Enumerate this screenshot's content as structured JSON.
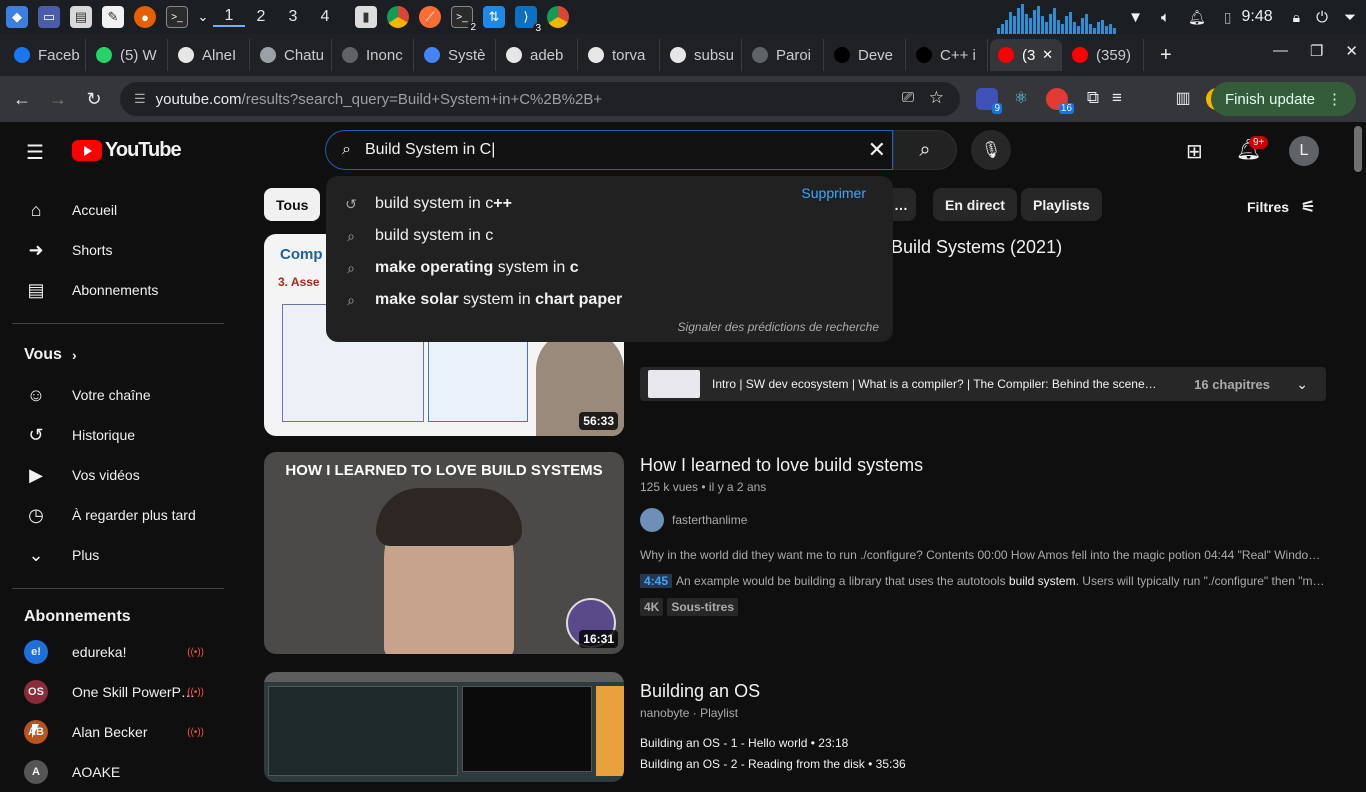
{
  "taskbar": {
    "workspaces": [
      "1",
      "2",
      "3",
      "4"
    ],
    "clock": "9:48",
    "badges": {
      "terminal": "2",
      "vscode": "3"
    }
  },
  "browser": {
    "tabs": [
      {
        "label": "Faceb",
        "icon": "facebook-icon",
        "color": "#1877f2"
      },
      {
        "label": "(5) W",
        "icon": "whatsapp-icon",
        "color": "#25d366"
      },
      {
        "label": "AlneI",
        "icon": "github-icon",
        "color": "#e6e6e6"
      },
      {
        "label": "Chatu",
        "icon": "openai-icon",
        "color": "#9aa0a6"
      },
      {
        "label": "Inonc",
        "icon": "page-icon",
        "color": "#5f6368"
      },
      {
        "label": "Systè",
        "icon": "google-icon",
        "color": "#4285f4"
      },
      {
        "label": "adeb",
        "icon": "github-icon",
        "color": "#e6e6e6"
      },
      {
        "label": "torva",
        "icon": "github-icon",
        "color": "#e6e6e6"
      },
      {
        "label": "subsu",
        "icon": "github-icon",
        "color": "#e6e6e6"
      },
      {
        "label": "Paroi",
        "icon": "page-icon",
        "color": "#5f6368"
      },
      {
        "label": "Deve",
        "icon": "devto-icon",
        "color": "#000000"
      },
      {
        "label": "C++ i",
        "icon": "devto-icon",
        "color": "#000000"
      },
      {
        "label": "(3",
        "icon": "youtube-icon",
        "color": "#ff0000",
        "active": true
      },
      {
        "label": "(359)",
        "icon": "youtube-icon",
        "color": "#ff0000"
      }
    ],
    "url_host": "youtube.com",
    "url_path": "/results?search_query=Build+System+in+C%2B%2B+",
    "finish_update": "Finish update",
    "ext_badges": {
      "a": "9",
      "b": "16"
    }
  },
  "youtube": {
    "logo_text": "YouTube",
    "search_value": "Build System in C",
    "notif_count": "9+",
    "avatar_letter": "L",
    "suggestions": {
      "items": [
        {
          "icon": "history-icon",
          "plain": "build system in c",
          "bold": "++",
          "bold_prefix": ""
        },
        {
          "icon": "search-icon",
          "plain": "build system in c",
          "bold": "",
          "bold_prefix": ""
        },
        {
          "icon": "search-icon",
          "bold_prefix": "make operating",
          "plain": " system in ",
          "bold": "c"
        },
        {
          "icon": "search-icon",
          "bold_prefix": "make solar",
          "plain": " system in ",
          "bold": "chart paper"
        }
      ],
      "delete_label": "Supprimer",
      "report_label": "Signaler des prédictions de recherche"
    },
    "sidebar": {
      "main": [
        {
          "label": "Accueil",
          "icon": "home-icon"
        },
        {
          "label": "Shorts",
          "icon": "shorts-icon"
        },
        {
          "label": "Abonnements",
          "icon": "subscriptions-icon"
        }
      ],
      "you_heading": "Vous",
      "you": [
        {
          "label": "Votre chaîne",
          "icon": "channel-icon"
        },
        {
          "label": "Historique",
          "icon": "history-icon"
        },
        {
          "label": "Vos vidéos",
          "icon": "videos-icon"
        },
        {
          "label": "À regarder plus tard",
          "icon": "watch-later-icon"
        },
        {
          "label": "Plus",
          "icon": "chevron-down-icon"
        }
      ],
      "subs_heading": "Abonnements",
      "subs": [
        {
          "label": "edureka!",
          "avatar": "e!",
          "color": "#1e6fd9"
        },
        {
          "label": "One Skill PowerP…",
          "avatar": "OS",
          "color": "#8a2b3a"
        },
        {
          "label": "Alan Becker",
          "avatar": "AB",
          "color": "#b5541c"
        },
        {
          "label": "AOAKE",
          "avatar": "A",
          "color": "#555555"
        }
      ]
    },
    "chips": {
      "all": "Tous",
      "more": "…",
      "live": "En direct",
      "playlists": "Playlists",
      "filters": "Filtres"
    },
    "results": [
      {
        "title": "Build Systems (2021)",
        "thumb_text_a": "Comp",
        "thumb_text_b": "3. Asse",
        "duration": "56:33",
        "chapters_text": "Intro | SW dev ecosystem | What is a compiler? | The Compiler: Behind the scenes |…",
        "chapters_count": "16 chapitres"
      },
      {
        "title": "How I learned to love build systems",
        "thumb_caption": "HOW I LEARNED TO LOVE BUILD SYSTEMS",
        "views": "125 k vues",
        "age": "il y a 2 ans",
        "channel": "fasterthanlime",
        "desc": "Why in the world did they want me to run ./configure? Contents 00:00 How Amos fell into the magic potion 04:44 \"Real\" Window…",
        "snippet_time": "4:45",
        "snippet_pre": "An example would be building a library that uses the autotools ",
        "snippet_bold": "build system",
        "snippet_post": ". Users will typically run \"./configure\" then \"m…",
        "badges": [
          "4K",
          "Sous-titres"
        ],
        "duration": "16:31"
      },
      {
        "title": "Building an OS",
        "channel": "nanobyte",
        "kind": "Playlist",
        "items": [
          {
            "label": "Building an OS - 1 - Hello world",
            "dur": "23:18"
          },
          {
            "label": "Building an OS - 2 - Reading from the disk",
            "dur": "35:36"
          }
        ]
      }
    ]
  }
}
